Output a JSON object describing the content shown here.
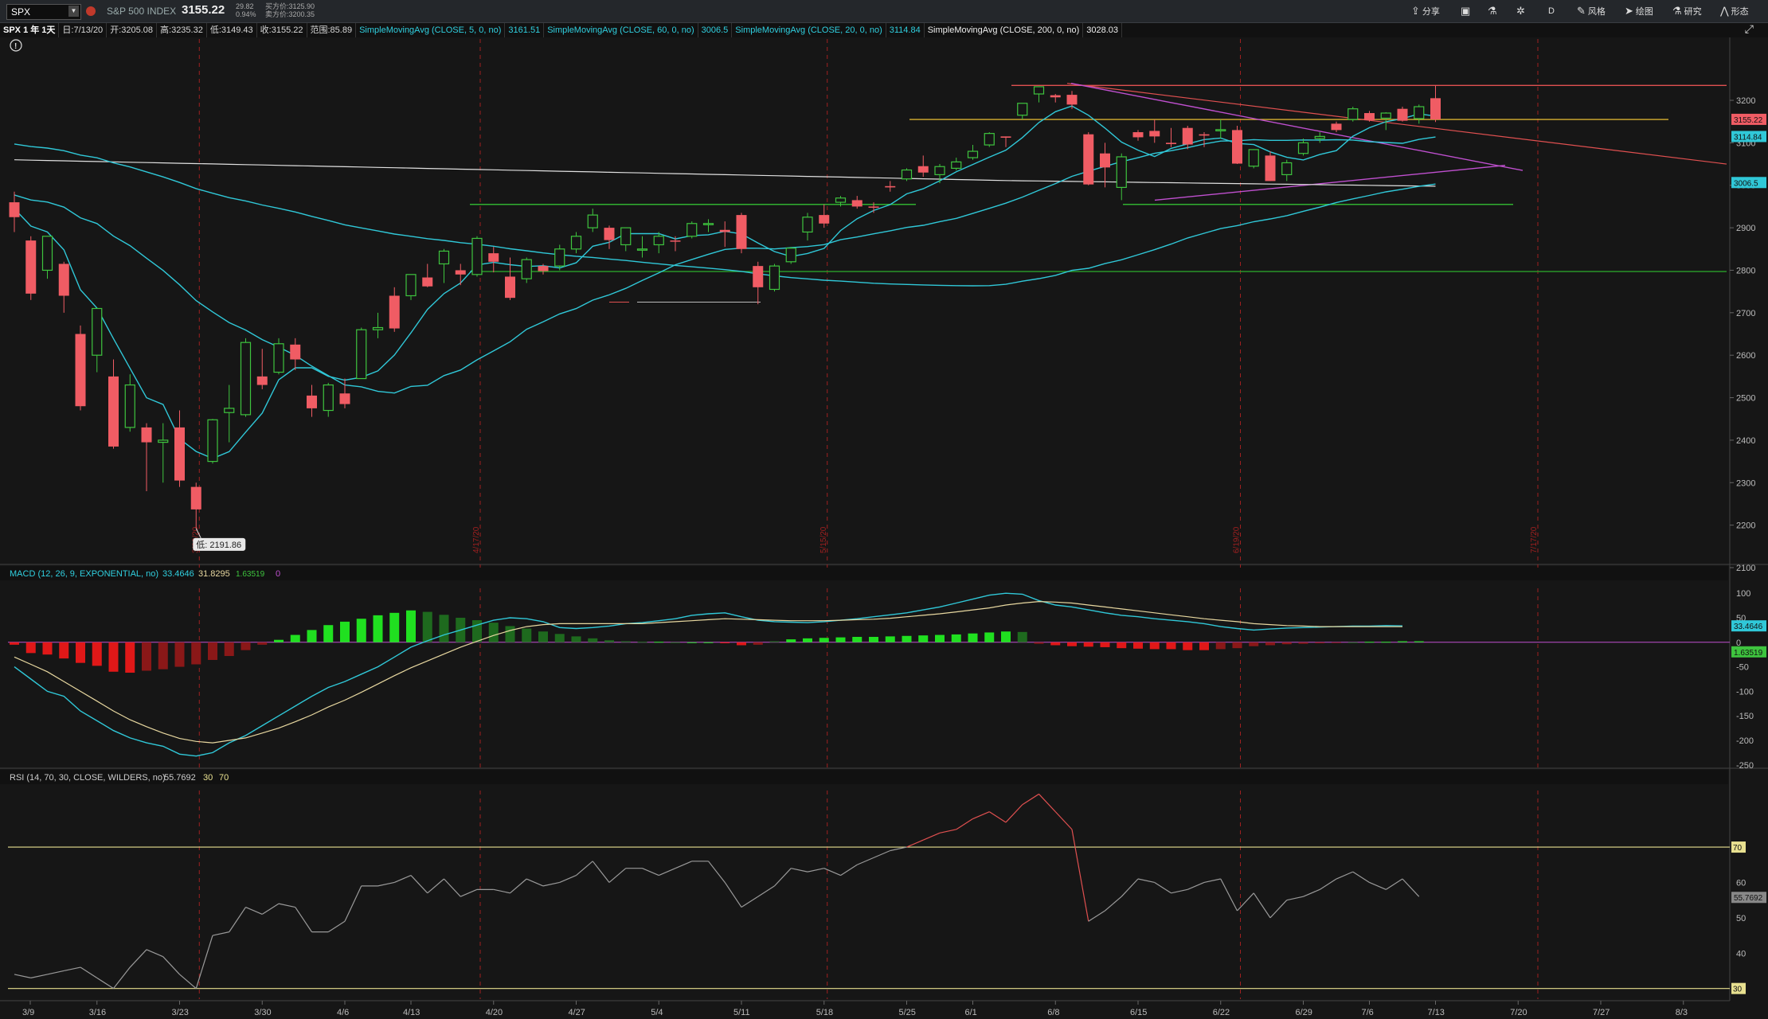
{
  "toolbar": {
    "symbol": "SPX",
    "index_name": "S&P 500 INDEX",
    "last_price": "3155.22",
    "change": "29.82",
    "change_pct": "0.94%",
    "bid": "买方价:3125.90",
    "ask": "卖方价:3200.35",
    "buttons": [
      {
        "label": "分享",
        "icon": "share-icon"
      },
      {
        "label": "",
        "icon": "monitor-icon"
      },
      {
        "label": "",
        "icon": "flask-icon"
      },
      {
        "label": "",
        "icon": "gear-icon"
      },
      {
        "label": "D",
        "icon": ""
      },
      {
        "label": "风格",
        "icon": "style-icon"
      },
      {
        "label": "绘图",
        "icon": "cursor-icon"
      },
      {
        "label": "研究",
        "icon": "flask-icon"
      },
      {
        "label": "形态",
        "icon": "pattern-icon"
      }
    ]
  },
  "infobar": {
    "title": "SPX 1 年 1天",
    "date": "日:7/13/20",
    "open": "开:3205.08",
    "high": "高:3235.32",
    "low": "低:3149.43",
    "close": "收:3155.22",
    "range": "范围:85.89",
    "studies": [
      {
        "label": "SimpleMovingAvg (CLOSE, 5, 0, no)",
        "value": "3161.51",
        "color": "#30d0e0"
      },
      {
        "label": "SimpleMovingAvg (CLOSE, 60, 0, no)",
        "value": "3006.5",
        "color": "#30d0e0"
      },
      {
        "label": "SimpleMovingAvg (CLOSE, 20, 0, no)",
        "value": "3114.84",
        "color": "#30d0e0"
      },
      {
        "label": "SimpleMovingAvg (CLOSE, 200, 0, no)",
        "value": "3028.03",
        "color": "#e8e8e8"
      }
    ]
  },
  "macd_header": {
    "label": "MACD (12, 26, 9, EXPONENTIAL, no)",
    "value": "33.4646",
    "avg": "31.8295",
    "diff": "1.63519",
    "zero": "0"
  },
  "rsi_header": {
    "label": "RSI (14, 70, 30, CLOSE, WILDERS, no)",
    "value": "55.7692",
    "ob": "30",
    "os": "70"
  },
  "low_tooltip": "低: 2191.86",
  "colors": {
    "up": "#3ec43e",
    "down": "#f05c64",
    "ma": "#30c8d8",
    "ma200": "#e0e0e0",
    "rsi": "#9a9a9a",
    "grid_v": "#a02020"
  },
  "chart_data": {
    "type": "candlestick",
    "price_axis": {
      "ylim": [
        2100,
        3260
      ],
      "ticks": [
        3200,
        3100,
        3000,
        2900,
        2800,
        2700,
        2600,
        2500,
        2400,
        2300,
        2200,
        2100
      ]
    },
    "price_labels": [
      {
        "value": 3155.22,
        "text": "3155.22",
        "color": "#f05c64"
      },
      {
        "value": 3114.84,
        "text": "3114.84",
        "color": "#30c8d8"
      },
      {
        "value": 3006.5,
        "text": "3006.5",
        "color": "#30c8d8"
      }
    ],
    "x_labels": [
      "3/9",
      "3/16",
      "3/23",
      "3/30",
      "4/6",
      "4/13",
      "4/20",
      "4/27",
      "5/4",
      "5/11",
      "5/18",
      "5/25",
      "6/1",
      "6/8",
      "6/15",
      "6/22",
      "6/29",
      "7/6",
      "7/13",
      "7/20",
      "7/27",
      "8/3"
    ],
    "month_markers": [
      "3/23/20",
      "4/17/20",
      "5/15/20",
      "6/19/20",
      "7/17/20"
    ],
    "candles": [
      {
        "o": 2960,
        "h": 2985,
        "l": 2890,
        "c": 2925
      },
      {
        "o": 2870,
        "h": 2880,
        "l": 2730,
        "c": 2745
      },
      {
        "o": 2800,
        "h": 2880,
        "l": 2780,
        "c": 2880
      },
      {
        "o": 2815,
        "h": 2820,
        "l": 2700,
        "c": 2740
      },
      {
        "o": 2650,
        "h": 2670,
        "l": 2470,
        "c": 2480
      },
      {
        "o": 2600,
        "h": 2710,
        "l": 2560,
        "c": 2710
      },
      {
        "o": 2550,
        "h": 2590,
        "l": 2380,
        "c": 2385
      },
      {
        "o": 2430,
        "h": 2555,
        "l": 2420,
        "c": 2530
      },
      {
        "o": 2430,
        "h": 2440,
        "l": 2280,
        "c": 2395
      },
      {
        "o": 2395,
        "h": 2440,
        "l": 2300,
        "c": 2400
      },
      {
        "o": 2430,
        "h": 2470,
        "l": 2290,
        "c": 2305
      },
      {
        "o": 2290,
        "h": 2300,
        "l": 2192,
        "c": 2237
      },
      {
        "o": 2350,
        "h": 2450,
        "l": 2345,
        "c": 2448
      },
      {
        "o": 2465,
        "h": 2530,
        "l": 2395,
        "c": 2475
      },
      {
        "o": 2460,
        "h": 2640,
        "l": 2455,
        "c": 2630
      },
      {
        "o": 2550,
        "h": 2615,
        "l": 2520,
        "c": 2530
      },
      {
        "o": 2560,
        "h": 2640,
        "l": 2555,
        "c": 2627
      },
      {
        "o": 2625,
        "h": 2640,
        "l": 2565,
        "c": 2590
      },
      {
        "o": 2505,
        "h": 2530,
        "l": 2455,
        "c": 2475
      },
      {
        "o": 2470,
        "h": 2535,
        "l": 2455,
        "c": 2530
      },
      {
        "o": 2510,
        "h": 2545,
        "l": 2475,
        "c": 2485
      },
      {
        "o": 2545,
        "h": 2665,
        "l": 2545,
        "c": 2660
      },
      {
        "o": 2660,
        "h": 2700,
        "l": 2640,
        "c": 2665
      },
      {
        "o": 2740,
        "h": 2760,
        "l": 2655,
        "c": 2663
      },
      {
        "o": 2740,
        "h": 2790,
        "l": 2730,
        "c": 2790
      },
      {
        "o": 2783,
        "h": 2815,
        "l": 2760,
        "c": 2762
      },
      {
        "o": 2815,
        "h": 2850,
        "l": 2770,
        "c": 2845
      },
      {
        "o": 2800,
        "h": 2815,
        "l": 2765,
        "c": 2790
      },
      {
        "o": 2790,
        "h": 2880,
        "l": 2785,
        "c": 2875
      },
      {
        "o": 2840,
        "h": 2855,
        "l": 2795,
        "c": 2820
      },
      {
        "o": 2785,
        "h": 2830,
        "l": 2730,
        "c": 2735
      },
      {
        "o": 2780,
        "h": 2830,
        "l": 2770,
        "c": 2825
      },
      {
        "o": 2810,
        "h": 2815,
        "l": 2790,
        "c": 2798
      },
      {
        "o": 2810,
        "h": 2860,
        "l": 2800,
        "c": 2850
      },
      {
        "o": 2850,
        "h": 2890,
        "l": 2840,
        "c": 2880
      },
      {
        "o": 2900,
        "h": 2945,
        "l": 2890,
        "c": 2930
      },
      {
        "o": 2900,
        "h": 2905,
        "l": 2850,
        "c": 2871
      },
      {
        "o": 2860,
        "h": 2900,
        "l": 2845,
        "c": 2900
      },
      {
        "o": 2850,
        "h": 2880,
        "l": 2830,
        "c": 2850
      },
      {
        "o": 2860,
        "h": 2890,
        "l": 2840,
        "c": 2880
      },
      {
        "o": 2870,
        "h": 2880,
        "l": 2845,
        "c": 2868
      },
      {
        "o": 2880,
        "h": 2915,
        "l": 2875,
        "c": 2910
      },
      {
        "o": 2910,
        "h": 2920,
        "l": 2890,
        "c": 2910
      },
      {
        "o": 2895,
        "h": 2915,
        "l": 2855,
        "c": 2890
      },
      {
        "o": 2930,
        "h": 2935,
        "l": 2840,
        "c": 2850
      },
      {
        "o": 2810,
        "h": 2820,
        "l": 2720,
        "c": 2760
      },
      {
        "o": 2755,
        "h": 2815,
        "l": 2750,
        "c": 2810
      },
      {
        "o": 2820,
        "h": 2855,
        "l": 2815,
        "c": 2852
      },
      {
        "o": 2890,
        "h": 2935,
        "l": 2870,
        "c": 2925
      },
      {
        "o": 2930,
        "h": 2955,
        "l": 2900,
        "c": 2910
      },
      {
        "o": 2960,
        "h": 2975,
        "l": 2950,
        "c": 2970
      },
      {
        "o": 2965,
        "h": 2975,
        "l": 2945,
        "c": 2950
      },
      {
        "o": 2950,
        "h": 2960,
        "l": 2935,
        "c": 2948
      },
      {
        "o": 2998,
        "h": 3010,
        "l": 2985,
        "c": 2995
      },
      {
        "o": 3015,
        "h": 3040,
        "l": 3010,
        "c": 3036
      },
      {
        "o": 3045,
        "h": 3070,
        "l": 3020,
        "c": 3030
      },
      {
        "o": 3025,
        "h": 3050,
        "l": 3005,
        "c": 3044
      },
      {
        "o": 3040,
        "h": 3065,
        "l": 3035,
        "c": 3055
      },
      {
        "o": 3065,
        "h": 3095,
        "l": 3060,
        "c": 3080
      },
      {
        "o": 3095,
        "h": 3125,
        "l": 3090,
        "c": 3122
      },
      {
        "o": 3115,
        "h": 3115,
        "l": 3090,
        "c": 3112
      },
      {
        "o": 3165,
        "h": 3190,
        "l": 3155,
        "c": 3193
      },
      {
        "o": 3215,
        "h": 3232,
        "l": 3195,
        "c": 3232
      },
      {
        "o": 3212,
        "h": 3215,
        "l": 3195,
        "c": 3207
      },
      {
        "o": 3213,
        "h": 3222,
        "l": 3180,
        "c": 3190
      },
      {
        "o": 3120,
        "h": 3125,
        "l": 3000,
        "c": 3002
      },
      {
        "o": 3075,
        "h": 3100,
        "l": 2995,
        "c": 3042
      },
      {
        "o": 2995,
        "h": 3075,
        "l": 2965,
        "c": 3067
      },
      {
        "o": 3125,
        "h": 3130,
        "l": 3105,
        "c": 3113
      },
      {
        "o": 3128,
        "h": 3155,
        "l": 3100,
        "c": 3115
      },
      {
        "o": 3100,
        "h": 3135,
        "l": 3090,
        "c": 3097
      },
      {
        "o": 3135,
        "h": 3140,
        "l": 3085,
        "c": 3096
      },
      {
        "o": 3120,
        "h": 3125,
        "l": 3090,
        "c": 3117
      },
      {
        "o": 3130,
        "h": 3155,
        "l": 3110,
        "c": 3131
      },
      {
        "o": 3130,
        "h": 3140,
        "l": 3050,
        "c": 3051
      },
      {
        "o": 3045,
        "h": 3085,
        "l": 3040,
        "c": 3084
      },
      {
        "o": 3070,
        "h": 3080,
        "l": 3010,
        "c": 3010
      },
      {
        "o": 3025,
        "h": 3060,
        "l": 3010,
        "c": 3053
      },
      {
        "o": 3075,
        "h": 3110,
        "l": 3070,
        "c": 3100
      },
      {
        "o": 3110,
        "h": 3125,
        "l": 3100,
        "c": 3115
      },
      {
        "o": 3145,
        "h": 3150,
        "l": 3125,
        "c": 3130
      },
      {
        "o": 3155,
        "h": 3185,
        "l": 3150,
        "c": 3180
      },
      {
        "o": 3170,
        "h": 3175,
        "l": 3150,
        "c": 3153
      },
      {
        "o": 3158,
        "h": 3172,
        "l": 3130,
        "c": 3170
      },
      {
        "o": 3180,
        "h": 3185,
        "l": 3150,
        "c": 3152
      },
      {
        "o": 3157,
        "h": 3190,
        "l": 3145,
        "c": 3185
      },
      {
        "o": 3205,
        "h": 3235,
        "l": 3149,
        "c": 3155
      }
    ],
    "macd": [
      -5,
      -22,
      -25,
      -33,
      -42,
      -48,
      -60,
      -62,
      -58,
      -55,
      -50,
      -45,
      -36,
      -28,
      -16,
      -5,
      5,
      15,
      25,
      35,
      42,
      48,
      55,
      60,
      65,
      62,
      56,
      50,
      45,
      40,
      33,
      28,
      22,
      17,
      12,
      8,
      4,
      2,
      1,
      1,
      0,
      0,
      0,
      -2,
      -6,
      -5,
      2,
      6,
      8,
      9,
      10,
      11,
      11,
      12,
      13,
      14,
      15,
      16,
      18,
      20,
      22,
      21,
      -3,
      -6,
      -8,
      -9,
      -10,
      -12,
      -13,
      -14,
      -14,
      -16,
      -16,
      -14,
      -12,
      -8,
      -6,
      -4,
      -3,
      -2,
      -1,
      0,
      1,
      1,
      2,
      2
    ],
    "macd_line": [
      -50,
      -75,
      -100,
      -110,
      -140,
      -160,
      -180,
      -195,
      -205,
      -212,
      -228,
      -232,
      -225,
      -205,
      -190,
      -170,
      -150,
      -130,
      -110,
      -92,
      -80,
      -65,
      -50,
      -30,
      -10,
      3,
      15,
      25,
      35,
      45,
      50,
      48,
      42,
      30,
      28,
      30,
      33,
      38,
      40,
      44,
      48,
      55,
      58,
      60,
      52,
      45,
      42,
      41,
      40,
      42,
      45,
      48,
      52,
      56,
      60,
      66,
      72,
      80,
      88,
      96,
      100,
      98,
      85,
      76,
      72,
      66,
      60,
      55,
      52,
      48,
      45,
      42,
      38,
      32,
      28,
      25,
      27,
      29,
      30,
      31,
      32,
      33,
      33,
      34,
      33.46
    ],
    "signal_line": [
      -30,
      -45,
      -60,
      -80,
      -100,
      -120,
      -140,
      -158,
      -172,
      -185,
      -196,
      -202,
      -205,
      -200,
      -195,
      -185,
      -175,
      -162,
      -148,
      -132,
      -118,
      -102,
      -85,
      -68,
      -52,
      -38,
      -24,
      -10,
      2,
      14,
      24,
      32,
      36,
      38,
      38,
      38,
      38,
      38,
      38,
      40,
      42,
      44,
      46,
      48,
      47,
      46,
      45,
      44,
      44,
      44,
      45,
      46,
      47,
      49,
      52,
      55,
      58,
      62,
      66,
      70,
      76,
      80,
      83,
      82,
      80,
      76,
      72,
      68,
      64,
      60,
      56,
      52,
      48,
      45,
      42,
      38,
      36,
      34,
      33,
      32,
      32,
      32,
      32,
      31.8,
      31.83
    ],
    "rsi": [
      34,
      33,
      34,
      35,
      36,
      33,
      30,
      36,
      41,
      39,
      34,
      30,
      45,
      46,
      53,
      51,
      54,
      53,
      46,
      46,
      49,
      59,
      59,
      60,
      62,
      57,
      61,
      56,
      58,
      58,
      57,
      61,
      59,
      60,
      62,
      66,
      60,
      64,
      64,
      62,
      64,
      66,
      66,
      60,
      53,
      56,
      59,
      64,
      63,
      64,
      62,
      65,
      67,
      69,
      70,
      72,
      74,
      75,
      78,
      80,
      77,
      82,
      85,
      80,
      75,
      49,
      52,
      56,
      61,
      60,
      57,
      58,
      60,
      61,
      52,
      57,
      50,
      55,
      56,
      58,
      61,
      63,
      60,
      58,
      61,
      56
    ],
    "rsi_axis": {
      "ticks": [
        70,
        60,
        50,
        40,
        30
      ],
      "overbought": 70,
      "oversold": 30
    },
    "macd_axis": {
      "ticks": [
        100,
        50,
        0,
        -50,
        -100,
        -150,
        -200,
        -250
      ]
    },
    "rsi_current": "55.7692",
    "macd_current": "33.4646",
    "macd_diff_current": "1.63519"
  }
}
